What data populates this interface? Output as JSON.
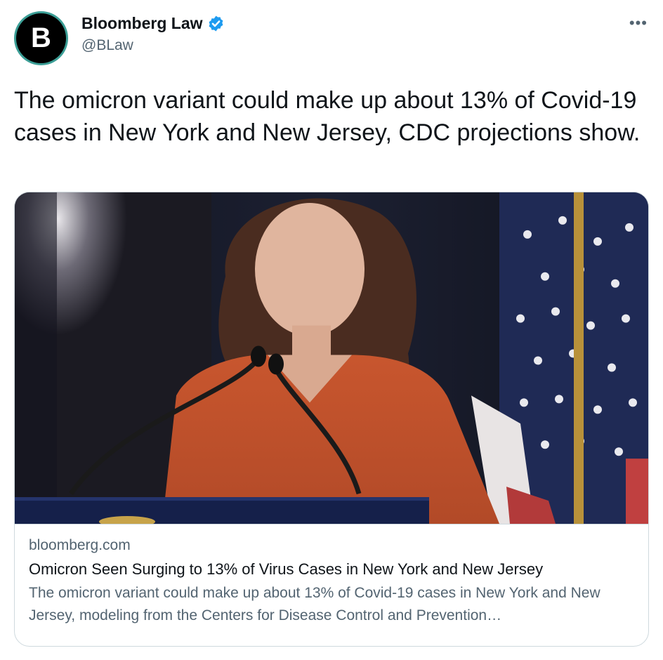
{
  "tweet": {
    "author": {
      "avatar_letter": "B",
      "display_name": "Bloomberg Law",
      "handle": "@BLaw",
      "verified_icon": "verified-badge-icon",
      "verified_color": "#1d9bf0"
    },
    "more_icon": "more-horizontal-icon",
    "text": "The omicron variant could make up about 13% of Covid-19 cases in New York and New Jersey, CDC projections show.",
    "card": {
      "domain": "bloomberg.com",
      "title": "Omicron Seen Surging to 13% of Virus Cases in New York and New Jersey",
      "description": "The omicron variant could make up about 13% of Covid-19 cases in New York and New Jersey, modeling from the Centers for Disease Control and Prevention…"
    }
  }
}
